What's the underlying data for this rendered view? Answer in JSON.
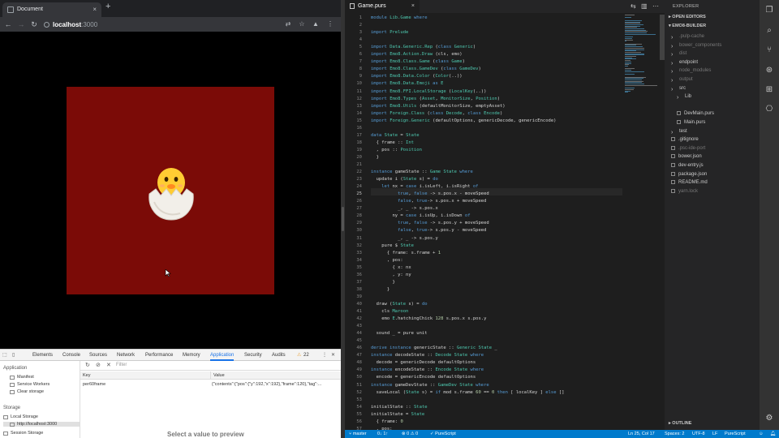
{
  "browser": {
    "tab_title": "Document",
    "new_tab": "+",
    "close_tab": "×",
    "url_host": "localhost",
    "url_port": ":3000"
  },
  "devtools": {
    "tabs": [
      "Elements",
      "Console",
      "Sources",
      "Network",
      "Performance",
      "Memory",
      "Application",
      "Security",
      "Audits"
    ],
    "active_tab": "Application",
    "warning_count": "22",
    "application_header": "Application",
    "application_items": [
      "Manifest",
      "Service Workers",
      "Clear storage"
    ],
    "storage_header": "Storage",
    "storage_items": [
      "Local Storage",
      "http://localhost:3000",
      "Session Storage"
    ],
    "filter_placeholder": "Filter",
    "columns": [
      "Key",
      "Value"
    ],
    "row_key": "per60frame",
    "row_value": "{\"contents\":{\"pos\":{\"y\":192,\"x\":192},\"frame\":120},\"tag\":...",
    "preview_text": "Select a value to preview"
  },
  "editor": {
    "tab_label": "Game.purs",
    "current_line": 25,
    "lines": [
      {
        "n": 1,
        "html": "<span class='k'>module</span> <span class='m'>Lib.Game</span> <span class='k'>where</span>"
      },
      {
        "n": 2,
        "html": ""
      },
      {
        "n": 3,
        "html": "<span class='k'>import</span> <span class='m'>Prelude</span>"
      },
      {
        "n": 4,
        "html": ""
      },
      {
        "n": 5,
        "html": "<span class='k'>import</span> <span class='m'>Data.Generic.Rep</span> (<span class='k'>class</span> <span class='m'>Generic</span>)"
      },
      {
        "n": 6,
        "html": "<span class='k'>import</span> <span class='m'>Emo8.Action.Draw</span> (cls, emo)"
      },
      {
        "n": 7,
        "html": "<span class='k'>import</span> <span class='m'>Emo8.Class.Game</span> (<span class='k'>class</span> <span class='m'>Game</span>)"
      },
      {
        "n": 8,
        "html": "<span class='k'>import</span> <span class='m'>Emo8.Class.GameDev</span> (<span class='k'>class</span> <span class='m'>GameDev</span>)"
      },
      {
        "n": 9,
        "html": "<span class='k'>import</span> <span class='m'>Emo8.Data.Color</span> (<span class='m'>Color</span>(..))"
      },
      {
        "n": 10,
        "html": "<span class='k'>import</span> <span class='m'>Emo8.Data.Emoji</span> <span class='k'>as</span> <span class='m'>E</span>"
      },
      {
        "n": 11,
        "html": "<span class='k'>import</span> <span class='m'>Emo8.FFI.LocalStorage</span> (<span class='m'>LocalKey</span>(..))"
      },
      {
        "n": 12,
        "html": "<span class='k'>import</span> <span class='m'>Emo8.Types</span> (<span class='m'>Asset</span>, <span class='m'>MonitorSize</span>, <span class='m'>Position</span>)"
      },
      {
        "n": 13,
        "html": "<span class='k'>import</span> <span class='m'>Emo8.Utils</span> (defaultMonitorSize, emptyAsset)"
      },
      {
        "n": 14,
        "html": "<span class='k'>import</span> <span class='m'>Foreign.Class</span> (<span class='k'>class</span> <span class='m'>Decode</span>, <span class='k'>class</span> <span class='m'>Encode</span>)"
      },
      {
        "n": 15,
        "html": "<span class='k'>import</span> <span class='m'>Foreign.Generic</span> (defaultOptions, genericDecode, genericEncode)"
      },
      {
        "n": 16,
        "html": ""
      },
      {
        "n": 17,
        "html": "<span class='k'>data</span> <span class='m'>State</span> = <span class='m'>State</span>"
      },
      {
        "n": 18,
        "html": "  { frame :: <span class='m'>Int</span>"
      },
      {
        "n": 19,
        "html": "  , pos :: <span class='m'>Position</span>"
      },
      {
        "n": 20,
        "html": "  }"
      },
      {
        "n": 21,
        "html": ""
      },
      {
        "n": 22,
        "html": "<span class='k'>instance</span> gameState :: <span class='m'>Game</span> <span class='m'>State</span> <span class='k'>where</span>"
      },
      {
        "n": 23,
        "html": "  update i (<span class='m'>State</span> s) = <span class='k'>do</span>"
      },
      {
        "n": 24,
        "html": "    <span class='k'>let</span> nx = <span class='k'>case</span> i.isLeft, i.isRight <span class='k'>of</span>"
      },
      {
        "n": 25,
        "html": "          <span class='k'>true</span>, <span class='k'>false</span> -> s.pos.x - moveSpeed"
      },
      {
        "n": 26,
        "html": "          <span class='k'>false</span>, <span class='k'>true</span>-> s.pos.x + moveSpeed"
      },
      {
        "n": 27,
        "html": "          _, _ -> s.pos.x"
      },
      {
        "n": 28,
        "html": "        ny = <span class='k'>case</span> i.isUp, i.isDown <span class='k'>of</span>"
      },
      {
        "n": 29,
        "html": "          <span class='k'>true</span>, <span class='k'>false</span> -> s.pos.y + moveSpeed"
      },
      {
        "n": 30,
        "html": "          <span class='k'>false</span>, <span class='k'>true</span>-> s.pos.y - moveSpeed"
      },
      {
        "n": 31,
        "html": "          _, _ -> s.pos.y"
      },
      {
        "n": 32,
        "html": "    pure $ <span class='m'>State</span>"
      },
      {
        "n": 33,
        "html": "      { frame: s.frame + <span class='n'>1</span>"
      },
      {
        "n": 34,
        "html": "      , pos:"
      },
      {
        "n": 35,
        "html": "        { x: nx"
      },
      {
        "n": 36,
        "html": "        , y: ny"
      },
      {
        "n": 37,
        "html": "        }"
      },
      {
        "n": 38,
        "html": "      }"
      },
      {
        "n": 39,
        "html": ""
      },
      {
        "n": 40,
        "html": "  draw (<span class='m'>State</span> s) = <span class='k'>do</span>"
      },
      {
        "n": 41,
        "html": "    cls <span class='m'>Maroon</span>"
      },
      {
        "n": 42,
        "html": "    emo <span class='m'>E</span>.hatchingChick <span class='n'>128</span> s.pos.x s.pos.y"
      },
      {
        "n": 43,
        "html": ""
      },
      {
        "n": 44,
        "html": "  sound _ = pure unit"
      },
      {
        "n": 45,
        "html": ""
      },
      {
        "n": 46,
        "html": "<span class='k'>derive instance</span> genericState :: <span class='m'>Generic</span> <span class='m'>State</span> _"
      },
      {
        "n": 47,
        "html": "<span class='k'>instance</span> decodeState :: <span class='m'>Decode</span> <span class='m'>State</span> <span class='k'>where</span>"
      },
      {
        "n": 48,
        "html": "  decode = genericDecode defaultOptions"
      },
      {
        "n": 49,
        "html": "<span class='k'>instance</span> encodeState :: <span class='m'>Encode</span> <span class='m'>State</span> <span class='k'>where</span>"
      },
      {
        "n": 50,
        "html": "  encode = genericEncode defaultOptions"
      },
      {
        "n": 51,
        "html": "<span class='k'>instance</span> gameDevState :: <span class='m'>GameDev</span> <span class='m'>State</span> <span class='k'>where</span>"
      },
      {
        "n": 52,
        "html": "  saveLocal (<span class='m'>State</span> s) = <span class='k'>if</span> mod s.frame <span class='n'>60</span> == <span class='n'>0</span> <span class='k'>then</span> [ localKey ] <span class='k'>else</span> []"
      },
      {
        "n": 53,
        "html": ""
      },
      {
        "n": 54,
        "html": "initialState :: <span class='m'>State</span>"
      },
      {
        "n": 55,
        "html": "initialState = <span class='m'>State</span>"
      },
      {
        "n": 56,
        "html": "  { frame: <span class='n'>0</span>"
      },
      {
        "n": 57,
        "html": "  , pos:"
      }
    ]
  },
  "explorer": {
    "title": "EXPLORER",
    "open_editors": "OPEN EDITORS",
    "project": "EMO8-BUILDER",
    "outline": "OUTLINE",
    "items": [
      {
        "label": ".pulp-cache",
        "depth": 1,
        "dim": true,
        "folder": true
      },
      {
        "label": "bower_components",
        "depth": 1,
        "dim": true,
        "folder": true
      },
      {
        "label": "dist",
        "depth": 1,
        "dim": true,
        "folder": true
      },
      {
        "label": "endpoint",
        "depth": 1,
        "dim": false,
        "folder": true
      },
      {
        "label": "node_modules",
        "depth": 1,
        "dim": true,
        "folder": true
      },
      {
        "label": "output",
        "depth": 1,
        "dim": true,
        "folder": true
      },
      {
        "label": "src",
        "depth": 1,
        "dim": false,
        "folder": true
      },
      {
        "label": "Lib",
        "depth": 2,
        "dim": false,
        "folder": true
      },
      {
        "label": "Game.purs",
        "depth": 3,
        "dim": false,
        "folder": false,
        "selected": true
      },
      {
        "label": "DevMain.purs",
        "depth": 2,
        "dim": false,
        "folder": false
      },
      {
        "label": "Main.purs",
        "depth": 2,
        "dim": false,
        "folder": false
      },
      {
        "label": "test",
        "depth": 1,
        "dim": false,
        "folder": true
      },
      {
        "label": ".gitignore",
        "depth": 1,
        "dim": false,
        "folder": false
      },
      {
        "label": ".psc-ide-port",
        "depth": 1,
        "dim": true,
        "folder": false
      },
      {
        "label": "bower.json",
        "depth": 1,
        "dim": false,
        "folder": false
      },
      {
        "label": "dev-entry.js",
        "depth": 1,
        "dim": false,
        "folder": false
      },
      {
        "label": "package.json",
        "depth": 1,
        "dim": false,
        "folder": false
      },
      {
        "label": "README.md",
        "depth": 1,
        "dim": false,
        "folder": false
      },
      {
        "label": "yarn.lock",
        "depth": 1,
        "dim": true,
        "folder": false
      }
    ]
  },
  "statusbar": {
    "branch": "master",
    "sync": "0↓ 1↑",
    "problems": "⊗ 0 ⚠ 0",
    "lang_server": "✓ PureScript",
    "position": "Ln 25, Col 17",
    "spaces": "Spaces: 2",
    "encoding": "UTF-8",
    "eol": "LF",
    "language": "PureScript"
  },
  "colors": {
    "game_background": "#7b0b07",
    "status_bar": "#007acc"
  }
}
